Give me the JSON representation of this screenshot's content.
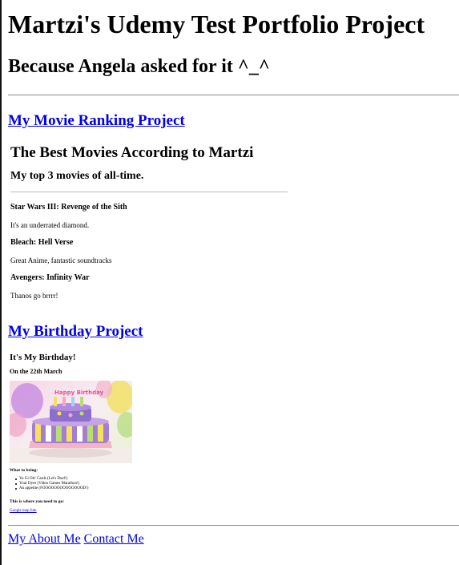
{
  "header": {
    "title": "Martzi's Udemy Test Portfolio Project",
    "subtitle": "Because Angela asked for it ^_^"
  },
  "movie_section": {
    "link_label": "My Movie Ranking Project",
    "title": "The Best Movies According to Martzi",
    "subtitle": "My top 3 movies of all-time.",
    "movies": [
      {
        "name": "Star Wars III: Revenge of the Sith",
        "desc": "It's an underrated diamond."
      },
      {
        "name": "Bleach: Hell Verse",
        "desc": "Great Anime, fantastic soundtracks"
      },
      {
        "name": "Avengers: Infinity War",
        "desc": "Thanos go brrrr!"
      }
    ]
  },
  "birthday_section": {
    "link_label": "My Birthday Project",
    "title": "It's My Birthday!",
    "date": "On the 22th March",
    "cake_topper": "Happy Birthday",
    "bring_heading": "What to bring:",
    "bring_items": [
      "Yu Gi Oh! Cards (Let's Duel!)",
      "Your Dyes (Video Games Marathon!)",
      "An appetite (FOOOOOOOOOOOOOOD!)"
    ],
    "where_heading": "This is where you need to go:",
    "map_link": "Google map link"
  },
  "footer": {
    "about_link": "My About Me",
    "contact_link": "Contact Me"
  },
  "colors": {
    "link": "#0000ee",
    "rule": "#888888"
  }
}
